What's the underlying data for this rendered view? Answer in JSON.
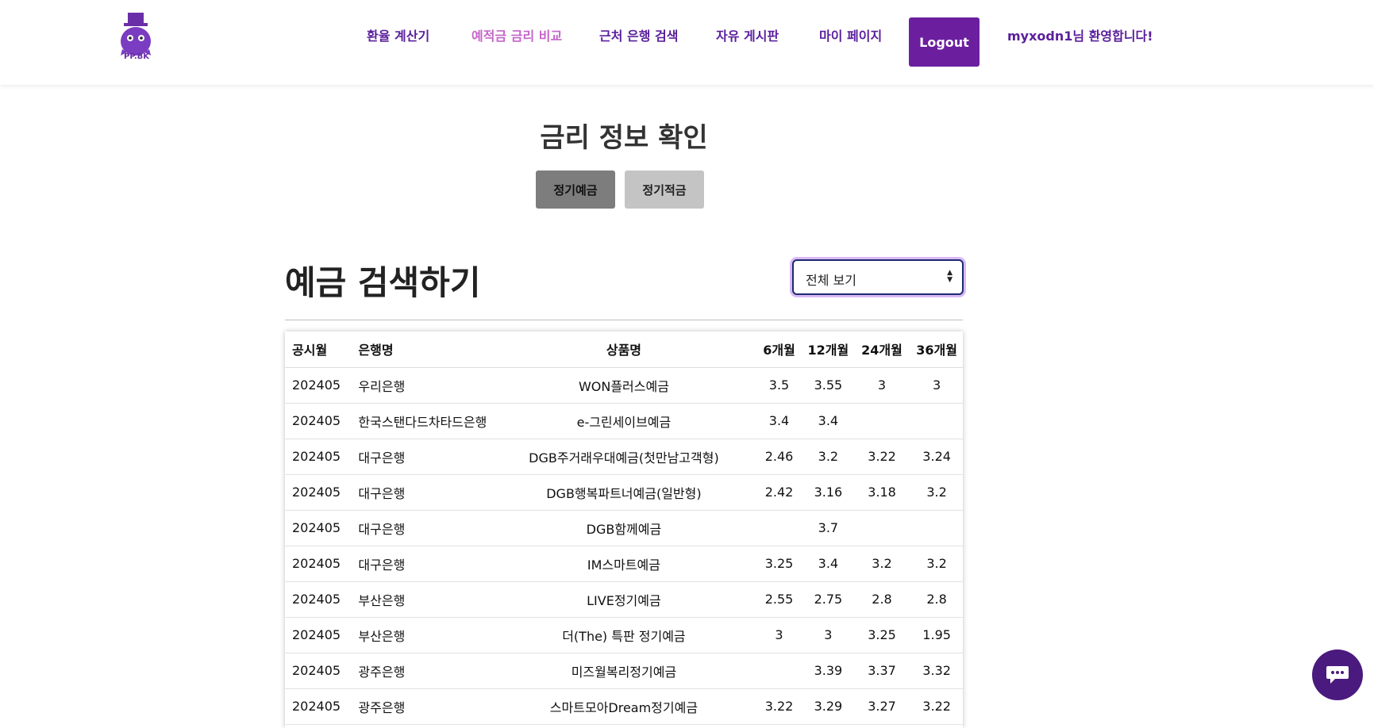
{
  "header": {
    "logo_text": "PP.BK",
    "nav": [
      {
        "label": "환율 계산기",
        "active": false
      },
      {
        "label": "예적금 금리 비교",
        "active": true
      },
      {
        "label": "근처 은행 검색",
        "active": false
      },
      {
        "label": "자유 게시판",
        "active": false
      },
      {
        "label": "마이 페이지",
        "active": false
      }
    ],
    "logout_label": "Logout",
    "welcome": "myxodn1님 환영합니다!"
  },
  "page_title": "금리 정보 확인",
  "toggles": {
    "deposit": "정기예금",
    "savings": "정기적금"
  },
  "section_title": "예금 검색하기",
  "filter": {
    "selected": "전체 보기"
  },
  "table": {
    "headers": [
      "공시월",
      "은행명",
      "상품명",
      "6개월",
      "12개월",
      "24개월",
      "36개월"
    ],
    "rows": [
      [
        "202405",
        "우리은행",
        "WON플러스예금",
        "3.5",
        "3.55",
        "3",
        "3"
      ],
      [
        "202405",
        "한국스탠다드차타드은행",
        "e-그린세이브예금",
        "3.4",
        "3.4",
        "",
        ""
      ],
      [
        "202405",
        "대구은행",
        "DGB주거래우대예금(첫만남고객형)",
        "2.46",
        "3.2",
        "3.22",
        "3.24"
      ],
      [
        "202405",
        "대구은행",
        "DGB행복파트너예금(일반형)",
        "2.42",
        "3.16",
        "3.18",
        "3.2"
      ],
      [
        "202405",
        "대구은행",
        "DGB함께예금",
        "",
        "3.7",
        "",
        ""
      ],
      [
        "202405",
        "대구은행",
        "IM스마트예금",
        "3.25",
        "3.4",
        "3.2",
        "3.2"
      ],
      [
        "202405",
        "부산은행",
        "LIVE정기예금",
        "2.55",
        "2.75",
        "2.8",
        "2.8"
      ],
      [
        "202405",
        "부산은행",
        "더(The) 특판 정기예금",
        "3",
        "3",
        "3.25",
        "1.95"
      ],
      [
        "202405",
        "광주은행",
        "미즈월복리정기예금",
        "",
        "3.39",
        "3.37",
        "3.32"
      ],
      [
        "202405",
        "광주은행",
        "스마트모아Dream정기예금",
        "3.22",
        "3.29",
        "3.27",
        "3.22"
      ]
    ]
  },
  "colors": {
    "brand": "#6b1f9e",
    "nav_text": "#5a1f9c",
    "nav_active": "#c465c9",
    "fab": "#4b1a7e"
  },
  "icons": {
    "logo": "mascot-logo",
    "chat": "chat-bubble-icon",
    "select": "sort-arrows-icon"
  }
}
